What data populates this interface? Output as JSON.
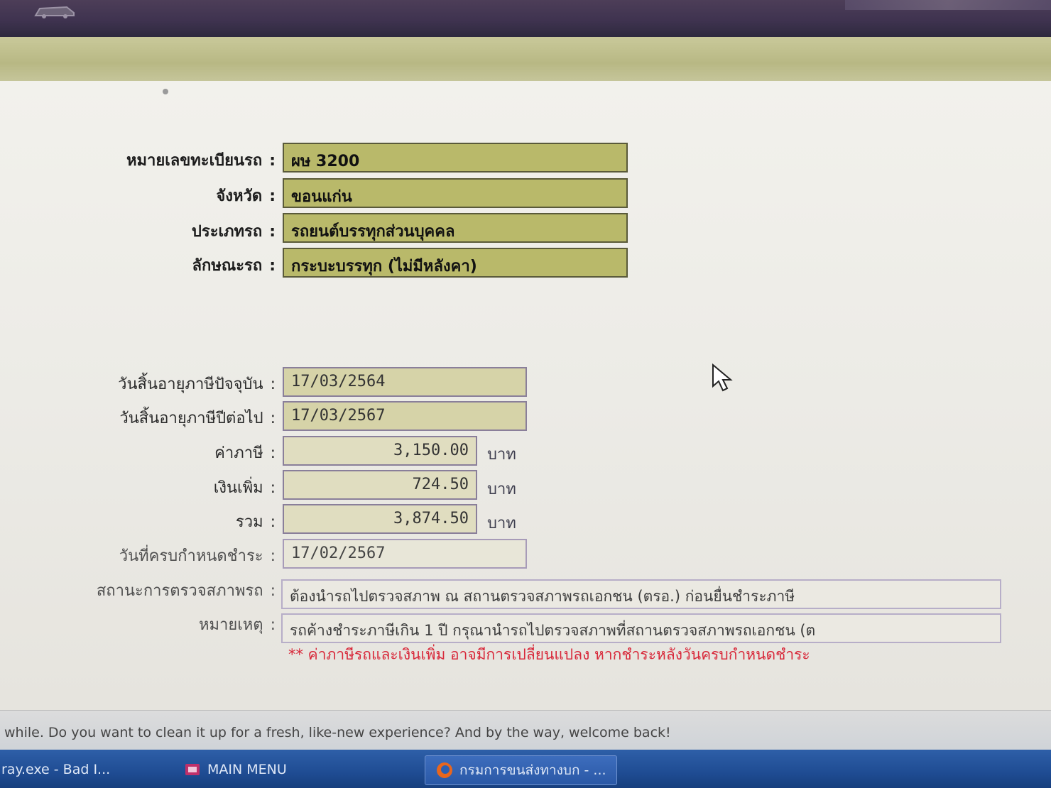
{
  "vehicle": {
    "plate_label": "หมายเลขทะเบียนรถ",
    "plate_value": "ผษ 3200",
    "province_label": "จังหวัด",
    "province_value": "ขอนแก่น",
    "type_label": "ประเภทรถ",
    "type_value": "รถยนต์บรรทุกส่วนบุคคล",
    "body_label": "ลักษณะรถ",
    "body_value": "กระบะบรรทุก (ไม่มีหลังคา)"
  },
  "tax": {
    "current_expiry_label": "วันสิ้นอายุภาษีปัจจุบัน",
    "current_expiry_value": "17/03/2564",
    "next_expiry_label": "วันสิ้นอายุภาษีปีต่อไป",
    "next_expiry_value": "17/03/2567",
    "tax_label": "ค่าภาษี",
    "tax_value": "3,150.00",
    "surcharge_label": "เงินเพิ่ม",
    "surcharge_value": "724.50",
    "total_label": "รวม",
    "total_value": "3,874.50",
    "unit": "บาท",
    "due_label": "วันที่ครบกำหนดชำระ",
    "due_value": "17/02/2567",
    "inspection_label": "สถานะการตรวจสภาพรถ",
    "inspection_value": "ต้องนำรถไปตรวจสภาพ ณ สถานตรวจสภาพรถเอกชน (ตรอ.) ก่อนยื่นชำระภาษี",
    "remark_label": "หมายเหตุ",
    "remark_value": "รถค้างชำระภาษีเกิน 1 ปี กรุณานำรถไปตรวจสภาพที่สถานตรวจสภาพรถเอกชน (ต",
    "warning": "** ค่าภาษีรถและเงินเพิ่ม อาจมีการเปลี่ยนแปลง หากชำระหลังวันครบกำหนดชำระ"
  },
  "colon": ":",
  "notification": "while. Do you want to clean it up for a fresh, like-new experience? And by the way, welcome back!",
  "taskbar": {
    "items": [
      {
        "label": "ray.exe - Bad I..."
      },
      {
        "label": "MAIN MENU"
      },
      {
        "label": "กรมการขนส่งทางบก - ..."
      }
    ]
  },
  "colors": {
    "olive_field": "#b9b96a",
    "tan_field": "#d6d3a8",
    "warning_red": "#d8283a",
    "taskbar_blue": "#1f4c93"
  }
}
